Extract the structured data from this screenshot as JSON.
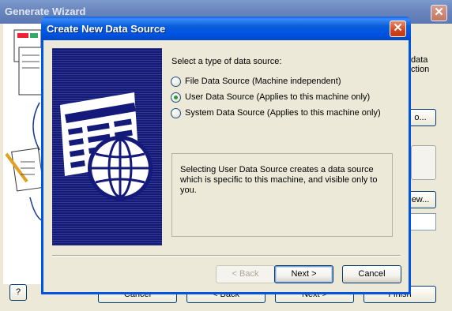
{
  "parent_window": {
    "title": "Generate Wizard",
    "side_text": "data\nction",
    "browse_button": "o...",
    "new_button": "ew...",
    "footer_buttons": [
      "Cancel",
      "< Back",
      "Next >",
      "Finish"
    ],
    "help_button": "?"
  },
  "dialog": {
    "title": "Create New Data Source",
    "prompt": "Select a type of data source:",
    "options": [
      {
        "label": "File Data Source (Machine independent)",
        "checked": false
      },
      {
        "label": "User Data Source (Applies to this machine only)",
        "checked": true
      },
      {
        "label": "System Data Source (Applies to this machine only)",
        "checked": false
      }
    ],
    "description": "Selecting User Data Source creates a data source which is specific to this machine, and visible only to you.",
    "buttons": {
      "back": "< Back",
      "next": "Next >",
      "cancel": "Cancel"
    },
    "close_icon": "close-icon",
    "panel_icons": [
      "table-grid-icon",
      "globe-icon"
    ]
  },
  "colors": {
    "title_blue": "#0054e3",
    "panel_navy": "#141a7a",
    "close_red": "#d2441c",
    "face": "#ece9d8"
  }
}
